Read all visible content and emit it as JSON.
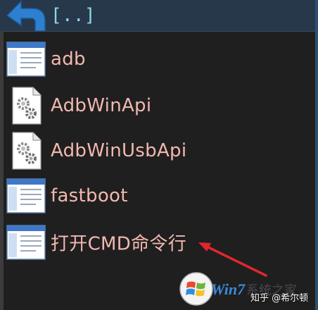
{
  "colors": {
    "background": "#1f1f1f",
    "top_bar": "#26384a",
    "label": "#f2b8b0",
    "updir_label": "#8fd6e8",
    "up_arrow": "#2f7fd0",
    "annotation_arrow": "#e0262e"
  },
  "updir": {
    "label": "[..]",
    "icon": "up-arrow-icon"
  },
  "files": [
    {
      "label": "adb",
      "icon": "executable-window-icon"
    },
    {
      "label": "AdbWinApi",
      "icon": "dll-gear-icon"
    },
    {
      "label": "AdbWinUsbApi",
      "icon": "dll-gear-icon"
    },
    {
      "label": "fastboot",
      "icon": "executable-window-icon"
    },
    {
      "label": "打开CMD命令行",
      "icon": "executable-window-icon"
    }
  ],
  "watermark": {
    "brand": "Win7",
    "faint": "系统之家",
    "credit": "知乎 @希尔顿"
  }
}
